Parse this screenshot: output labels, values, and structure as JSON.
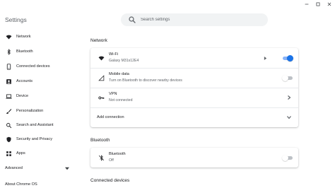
{
  "app": {
    "title": "Settings"
  },
  "search": {
    "placeholder": "Search settings"
  },
  "window": {
    "controls": [
      "minimize-icon",
      "maximize-icon",
      "close-icon"
    ]
  },
  "sidebar": {
    "items": [
      {
        "label": "Network",
        "icon": "wifi-icon"
      },
      {
        "label": "Bluetooth",
        "icon": "bluetooth-icon"
      },
      {
        "label": "Connected devices",
        "icon": "phone-icon"
      },
      {
        "label": "Accounts",
        "icon": "person-icon"
      },
      {
        "label": "Device",
        "icon": "laptop-icon"
      },
      {
        "label": "Personalization",
        "icon": "brush-icon"
      },
      {
        "label": "Search and Assistant",
        "icon": "search-icon"
      },
      {
        "label": "Security and Privacy",
        "icon": "shield-icon"
      },
      {
        "label": "Apps",
        "icon": "apps-grid-icon"
      }
    ],
    "advanced": "Advanced",
    "about": "About Chrome OS"
  },
  "network": {
    "section_title": "Network",
    "wifi": {
      "title": "Wi-Fi",
      "subtitle": "Galaxy M31s12E4",
      "enabled": true
    },
    "mobile": {
      "title": "Mobile data",
      "subtitle": "Turn on Bluetooth to discover nearby devices",
      "enabled": false
    },
    "vpn": {
      "title": "VPN",
      "subtitle": "Not connected"
    },
    "add_connection": "Add connection"
  },
  "bluetooth": {
    "section_title": "Bluetooth",
    "row": {
      "title": "Bluetooth",
      "subtitle": "Off",
      "enabled": false
    }
  },
  "connected_devices": {
    "section_title": "Connected devices"
  },
  "colors": {
    "accent": "#1a73e8",
    "text": "#202124",
    "secondary": "#5f6368",
    "search_bg": "#f1f3f4"
  }
}
